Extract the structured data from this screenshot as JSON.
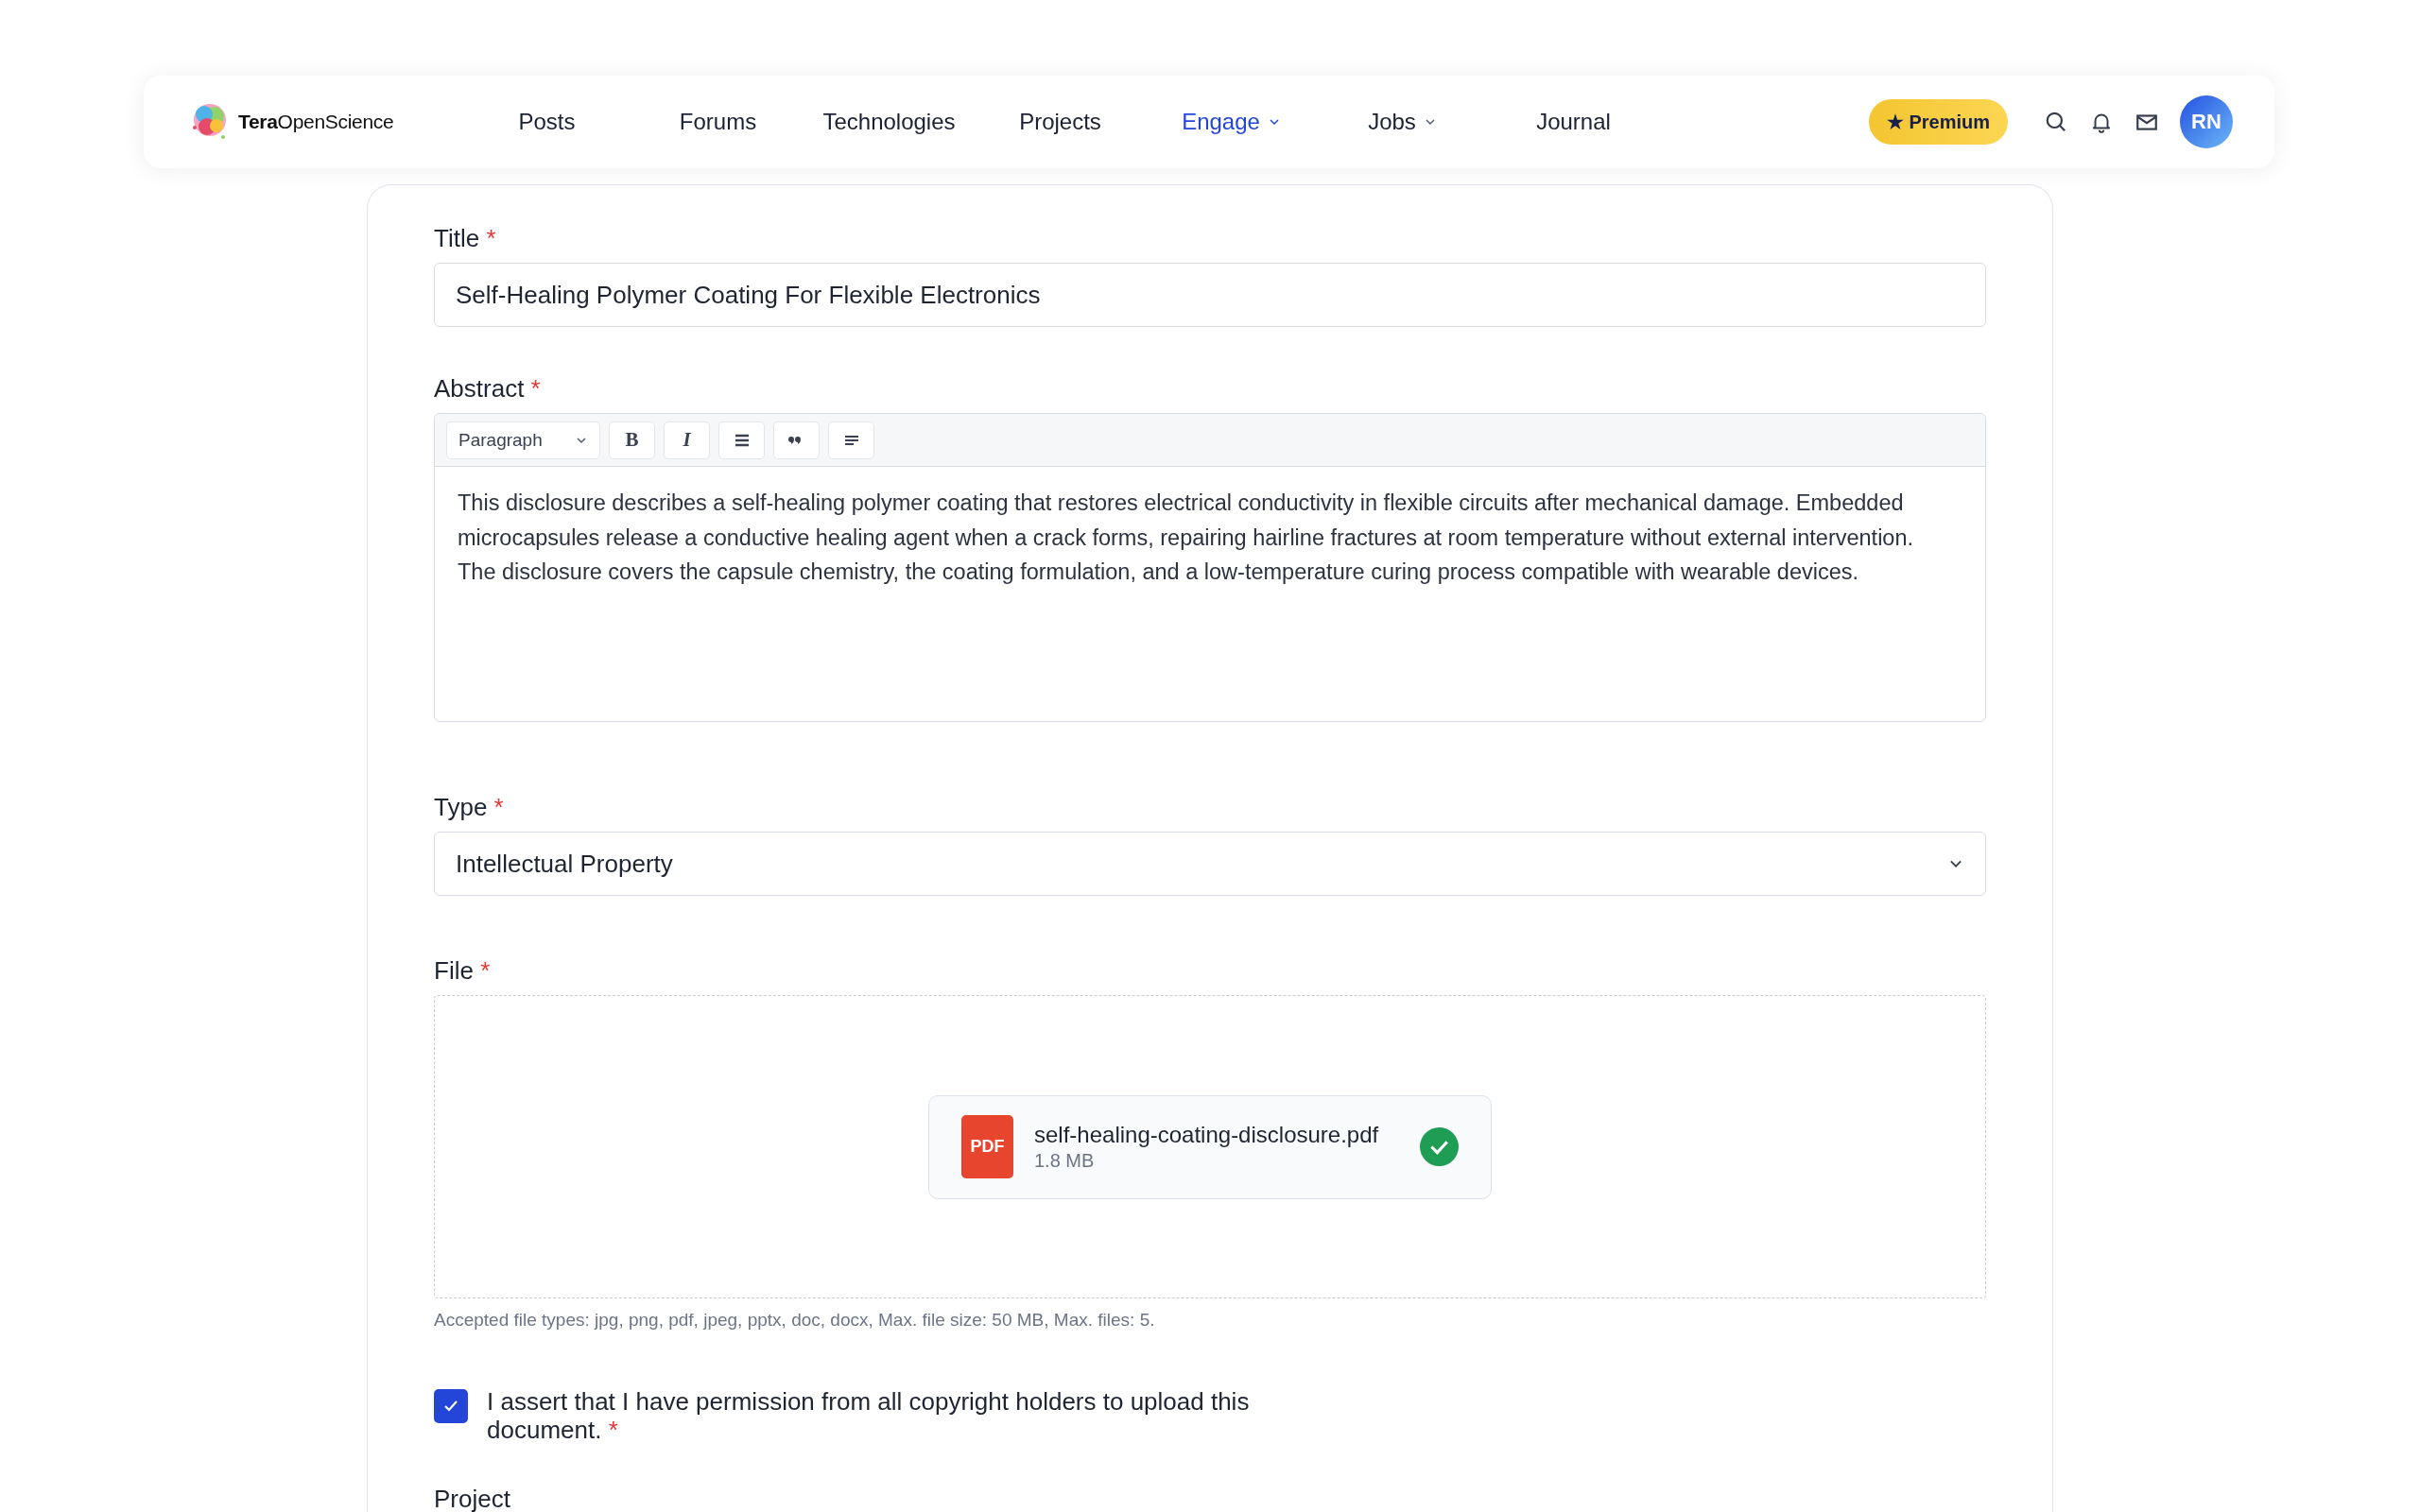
{
  "header": {
    "logo": "**Tera**OpenScience",
    "nav": [
      {
        "label": "Posts",
        "selected": false,
        "dropdown": false
      },
      {
        "label": "Forums",
        "selected": false,
        "dropdown": false
      },
      {
        "label": "Technologies",
        "selected": false,
        "dropdown": false
      },
      {
        "label": "Projects",
        "selected": false,
        "dropdown": false
      },
      {
        "label": "Engage",
        "selected": true,
        "dropdown": true
      },
      {
        "label": "Jobs",
        "selected": false,
        "dropdown": true
      },
      {
        "label": "Journal",
        "selected": false,
        "dropdown": false
      }
    ],
    "premium": "★ Premium",
    "avatar": "RN"
  },
  "form": {
    "title": {
      "label": "Title",
      "required_mark": "*",
      "value": "Self-Healing Polymer Coating For Flexible Electronics"
    },
    "abstract": {
      "label": "Abstract",
      "required_mark": "*",
      "block_format": "Paragraph",
      "toolbar": [
        {
          "kind": "bold",
          "label": "B"
        },
        {
          "kind": "italic",
          "label": "I"
        },
        {
          "kind": "list"
        },
        {
          "kind": "quote"
        },
        {
          "kind": "align"
        }
      ],
      "text": "This disclosure describes a self-healing polymer coating that restores electrical conductivity in flexible circuits after mechanical damage. Embedded microcapsules release a conductive healing agent when a crack forms, repairing hairline fractures at room temperature without external intervention. The disclosure covers the capsule chemistry, the coating formulation, and a low-temperature curing process compatible with wearable devices."
    },
    "type": {
      "label": "Type",
      "required_mark": "*",
      "value": "Intellectual Property"
    },
    "file": {
      "label": "File",
      "required_mark": "*",
      "badge": "PDF",
      "name": "self-healing-coating-disclosure.pdf",
      "size": "1.8 MB",
      "uploaded": true,
      "hint": "Accepted file types: jpg, png, pdf, jpeg, pptx, doc, docx, Max. file size: 50 MB, Max. files: 5."
    },
    "consent": {
      "checked": true,
      "text": "I assert that I have permission from all copyright holders to upload this document.",
      "required_mark": "*"
    },
    "project": {
      "label": "Project"
    }
  }
}
